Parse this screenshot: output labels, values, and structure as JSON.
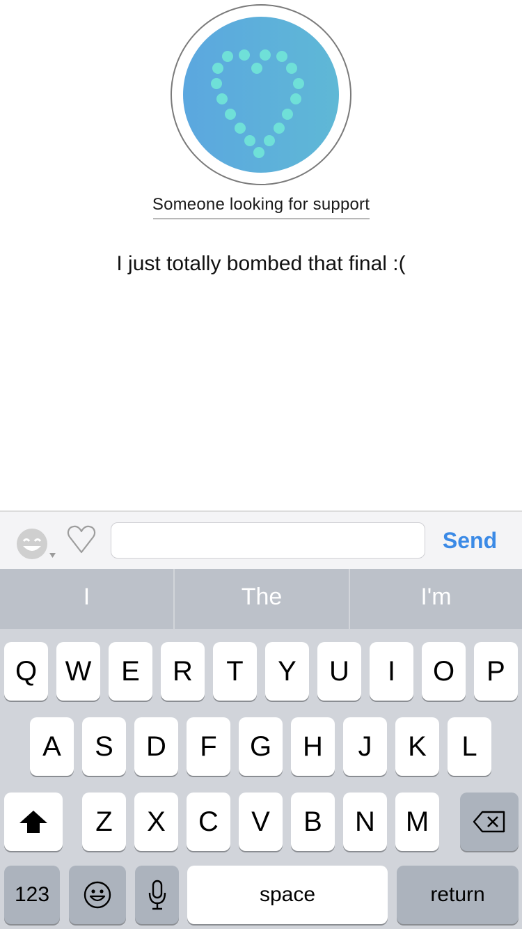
{
  "profile": {
    "sender_name": "Someone looking for support"
  },
  "message": {
    "text": "I just totally bombed that final :("
  },
  "compose": {
    "input_value": "",
    "input_placeholder": "",
    "send_label": "Send",
    "emoji_icon": "smiley-emoji-icon",
    "heart_icon": "heart-outline-icon"
  },
  "keyboard": {
    "predictions": [
      "I",
      "The",
      "I'm"
    ],
    "row1": [
      "Q",
      "W",
      "E",
      "R",
      "T",
      "Y",
      "U",
      "I",
      "O",
      "P"
    ],
    "row2": [
      "A",
      "S",
      "D",
      "F",
      "G",
      "H",
      "J",
      "K",
      "L"
    ],
    "row3": [
      "Z",
      "X",
      "C",
      "V",
      "B",
      "N",
      "M"
    ],
    "numbers_label": "123",
    "space_label": "space",
    "return_label": "return",
    "shift_icon": "shift-arrow-icon",
    "delete_icon": "backspace-icon",
    "emoji_key_icon": "emoji-face-icon",
    "mic_icon": "microphone-icon"
  },
  "colors": {
    "accent": "#3b8ae6",
    "avatar_gradient_start": "#5ba7df",
    "avatar_gradient_end": "#5fb8d6",
    "heart_dots": "#6fe0d8"
  }
}
